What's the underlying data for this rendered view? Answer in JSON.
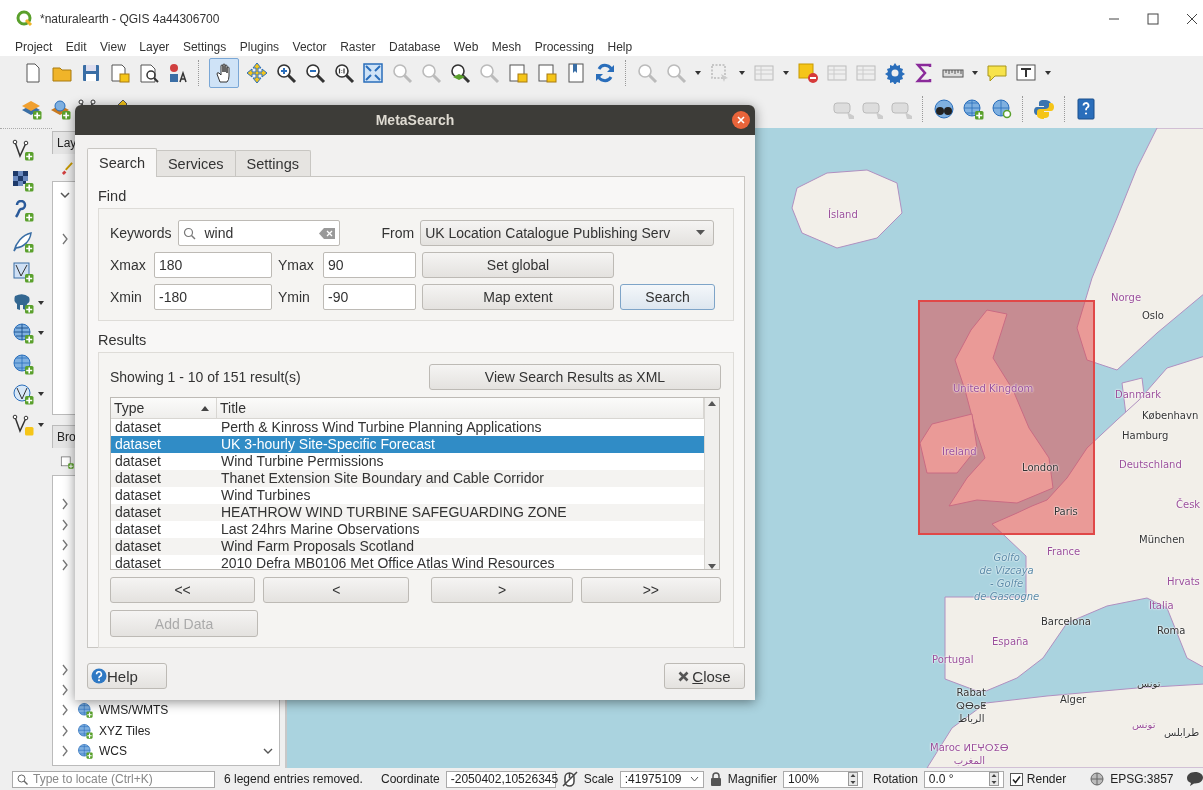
{
  "window": {
    "title": "*naturalearth - QGIS 4a44306700"
  },
  "menu": [
    "Project",
    "Edit",
    "View",
    "Layer",
    "Settings",
    "Plugins",
    "Vector",
    "Raster",
    "Database",
    "Web",
    "Mesh",
    "Processing",
    "Help"
  ],
  "toolbar": {
    "pan_tool_active": true
  },
  "layers_panel": {
    "title": "Lay"
  },
  "browser_panel": {
    "title": "Bro",
    "items": [
      {
        "label": "WMS/WMTS",
        "expanded": false
      },
      {
        "label": "XYZ Tiles",
        "expanded": false
      },
      {
        "label": "WCS",
        "expanded": false
      }
    ]
  },
  "map": {
    "labels": [
      {
        "text": "Ísland",
        "kind": "country"
      },
      {
        "text": "Norge",
        "kind": "country"
      },
      {
        "text": "Oslo",
        "kind": "city"
      },
      {
        "text": "United Kingdom",
        "kind": "country"
      },
      {
        "text": "Danmark",
        "kind": "country"
      },
      {
        "text": "København",
        "kind": "city"
      },
      {
        "text": "Hamburg",
        "kind": "city"
      },
      {
        "text": "Ireland",
        "kind": "country"
      },
      {
        "text": "Deutschland",
        "kind": "country"
      },
      {
        "text": "London",
        "kind": "city"
      },
      {
        "text": "Česk",
        "kind": "country"
      },
      {
        "text": "Paris",
        "kind": "city"
      },
      {
        "text": "München",
        "kind": "city"
      },
      {
        "text": "France",
        "kind": "country"
      },
      {
        "text": "Golfo\nde Vizcaya\n- Golfe\nde Gascogne",
        "kind": "sea"
      },
      {
        "text": "Hrvats",
        "kind": "country"
      },
      {
        "text": "Italia",
        "kind": "country"
      },
      {
        "text": "Barcelona",
        "kind": "city"
      },
      {
        "text": "Roma",
        "kind": "city"
      },
      {
        "text": "España",
        "kind": "country"
      },
      {
        "text": "Portugal",
        "kind": "country"
      },
      {
        "text": "تونس",
        "kind": "city"
      },
      {
        "text": "Alger",
        "kind": "city"
      },
      {
        "text": "Rabat\nⵕⴱⴰⵟ\nالرباط",
        "kind": "city"
      },
      {
        "text": "تونس",
        "kind": "country"
      },
      {
        "text": "طرابلس",
        "kind": "city"
      },
      {
        "text": "Maroc ⵍⵎⵖⵔⵉⴱ\nالمغرب",
        "kind": "country"
      }
    ]
  },
  "dialog": {
    "title": "MetaSearch",
    "tabs": [
      {
        "label": "Search",
        "selected": true
      },
      {
        "label": "Services",
        "selected": false
      },
      {
        "label": "Settings",
        "selected": false
      }
    ],
    "find": {
      "title": "Find",
      "keywords_label": "Keywords",
      "keywords": "wind",
      "from_label": "From",
      "from": "UK Location Catalogue Publishing Serv",
      "xmax_label": "Xmax",
      "xmax": "180",
      "ymax_label": "Ymax",
      "ymax": "90",
      "xmin_label": "Xmin",
      "xmin": "-180",
      "ymin_label": "Ymin",
      "ymin": "-90",
      "set_global": "Set global",
      "map_extent": "Map extent",
      "search": "Search"
    },
    "results": {
      "title": "Results",
      "summary": "Showing 1 - 10 of 151 result(s)",
      "view_xml": "View Search Results as XML",
      "columns": [
        {
          "label": "Type",
          "sorted": true
        },
        {
          "label": "Title",
          "sorted": false
        }
      ],
      "rows": [
        {
          "type": "dataset",
          "title": "Perth & Kinross Wind Turbine Planning Applications",
          "selected": false
        },
        {
          "type": "dataset",
          "title": "UK 3-hourly Site-Specific Forecast",
          "selected": true
        },
        {
          "type": "dataset",
          "title": "Wind Turbine Permissions",
          "selected": false
        },
        {
          "type": "dataset",
          "title": "Thanet Extension Site Boundary and Cable Corridor",
          "selected": false
        },
        {
          "type": "dataset",
          "title": "Wind Turbines",
          "selected": false
        },
        {
          "type": "dataset",
          "title": "HEATHROW WIND TURBINE SAFEGUARDING ZONE",
          "selected": false
        },
        {
          "type": "dataset",
          "title": "Last 24hrs Marine Observations",
          "selected": false
        },
        {
          "type": "dataset",
          "title": "Wind Farm Proposals Scotland",
          "selected": false
        },
        {
          "type": "dataset",
          "title": "2010 Defra MB0106 Met Office Atlas Wind Resources",
          "selected": false
        }
      ],
      "pager": [
        "<<",
        "<",
        ">",
        ">>"
      ],
      "add_data": {
        "label": "Add Data",
        "disabled": true
      }
    },
    "help": "Help",
    "close": "Close"
  },
  "status_bar": {
    "locate_placeholder": "Type to locate (Ctrl+K)",
    "message": "6 legend entries removed.",
    "coordinate_label": "Coordinate",
    "coordinate": "-2050402,10526345",
    "scale_label": "Scale",
    "scale": ":41975109",
    "magnifier_label": "Magnifier",
    "magnifier": "100%",
    "rotation_label": "Rotation",
    "rotation": "0.0 °",
    "render": {
      "label": "Render",
      "checked": true
    },
    "crs": "EPSG:3857"
  }
}
